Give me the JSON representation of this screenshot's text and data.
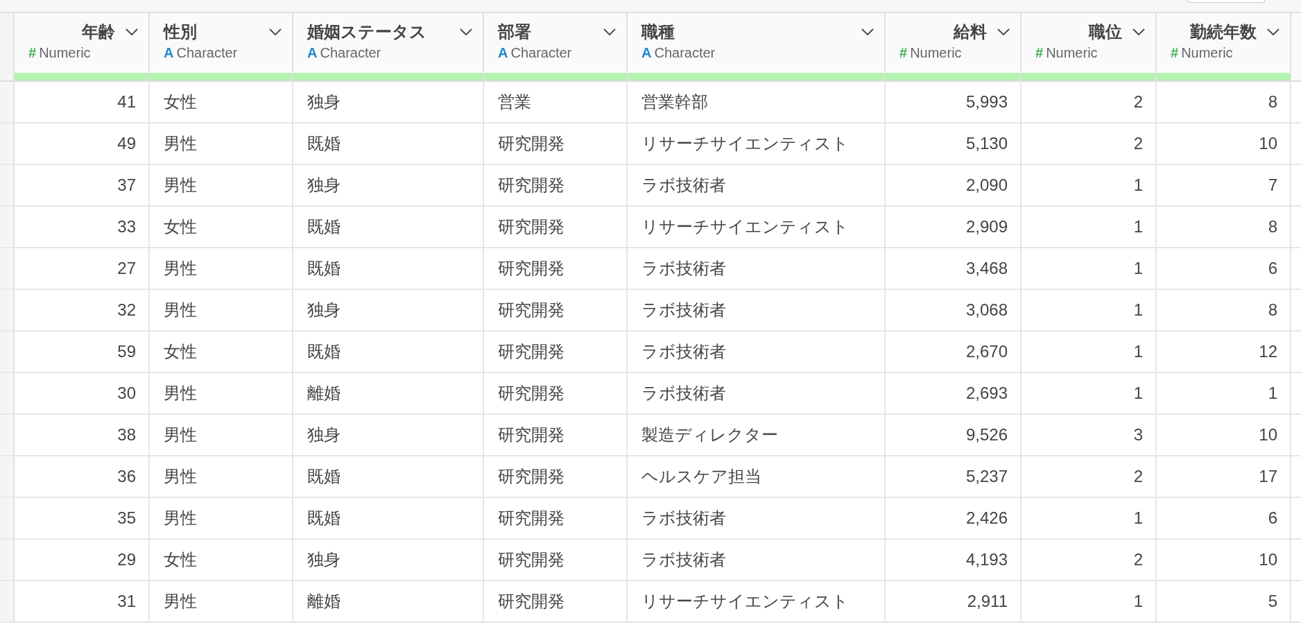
{
  "columns": [
    {
      "title": "年齢",
      "kind": "numeric",
      "type_icon": "#",
      "type_label": "Numeric",
      "level": 1
    },
    {
      "title": "性別",
      "kind": "character",
      "type_icon": "A",
      "type_label": "Character",
      "level": 1
    },
    {
      "title": "婚姻ステータス",
      "kind": "character",
      "type_icon": "A",
      "type_label": "Character",
      "level": 1
    },
    {
      "title": "部署",
      "kind": "character",
      "type_icon": "A",
      "type_label": "Character",
      "level": 1
    },
    {
      "title": "職種",
      "kind": "character",
      "type_icon": "A",
      "type_label": "Character",
      "level": 1
    },
    {
      "title": "給料",
      "kind": "numeric",
      "type_icon": "#",
      "type_label": "Numeric",
      "level": 1
    },
    {
      "title": "職位",
      "kind": "numeric",
      "type_icon": "#",
      "type_label": "Numeric",
      "level": 1
    },
    {
      "title": "勤続年数",
      "kind": "numeric",
      "type_icon": "#",
      "type_label": "Numeric",
      "level": 1
    }
  ],
  "rows": [
    [
      "41",
      "女性",
      "独身",
      "営業",
      "営業幹部",
      "5,993",
      "2",
      "8"
    ],
    [
      "49",
      "男性",
      "既婚",
      "研究開発",
      "リサーチサイエンティスト",
      "5,130",
      "2",
      "10"
    ],
    [
      "37",
      "男性",
      "独身",
      "研究開発",
      "ラボ技術者",
      "2,090",
      "1",
      "7"
    ],
    [
      "33",
      "女性",
      "既婚",
      "研究開発",
      "リサーチサイエンティスト",
      "2,909",
      "1",
      "8"
    ],
    [
      "27",
      "男性",
      "既婚",
      "研究開発",
      "ラボ技術者",
      "3,468",
      "1",
      "6"
    ],
    [
      "32",
      "男性",
      "独身",
      "研究開発",
      "ラボ技術者",
      "3,068",
      "1",
      "8"
    ],
    [
      "59",
      "女性",
      "既婚",
      "研究開発",
      "ラボ技術者",
      "2,670",
      "1",
      "12"
    ],
    [
      "30",
      "男性",
      "離婚",
      "研究開発",
      "ラボ技術者",
      "2,693",
      "1",
      "1"
    ],
    [
      "38",
      "男性",
      "独身",
      "研究開発",
      "製造ディレクター",
      "9,526",
      "3",
      "10"
    ],
    [
      "36",
      "男性",
      "既婚",
      "研究開発",
      "ヘルスケア担当",
      "5,237",
      "2",
      "17"
    ],
    [
      "35",
      "男性",
      "既婚",
      "研究開発",
      "ラボ技術者",
      "2,426",
      "1",
      "6"
    ],
    [
      "29",
      "女性",
      "独身",
      "研究開発",
      "ラボ技術者",
      "4,193",
      "2",
      "10"
    ],
    [
      "31",
      "男性",
      "離婚",
      "研究開発",
      "リサーチサイエンティスト",
      "2,911",
      "1",
      "5"
    ]
  ]
}
